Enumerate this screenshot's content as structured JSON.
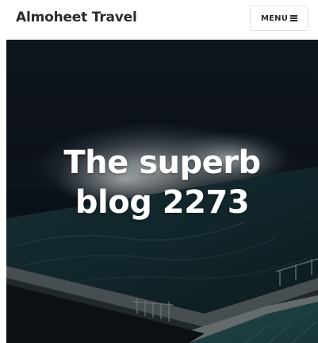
{
  "header": {
    "site_title": "Almoheet Travel",
    "menu_label": "MENU"
  },
  "hero": {
    "title_line_1": "The superb",
    "title_line_2": "blog 2273",
    "image_description_icon": "night-pool-waves-image"
  },
  "colors": {
    "header_text": "#2b2b2b",
    "hero_text": "#ffffff",
    "hero_background": "#0f1419"
  }
}
